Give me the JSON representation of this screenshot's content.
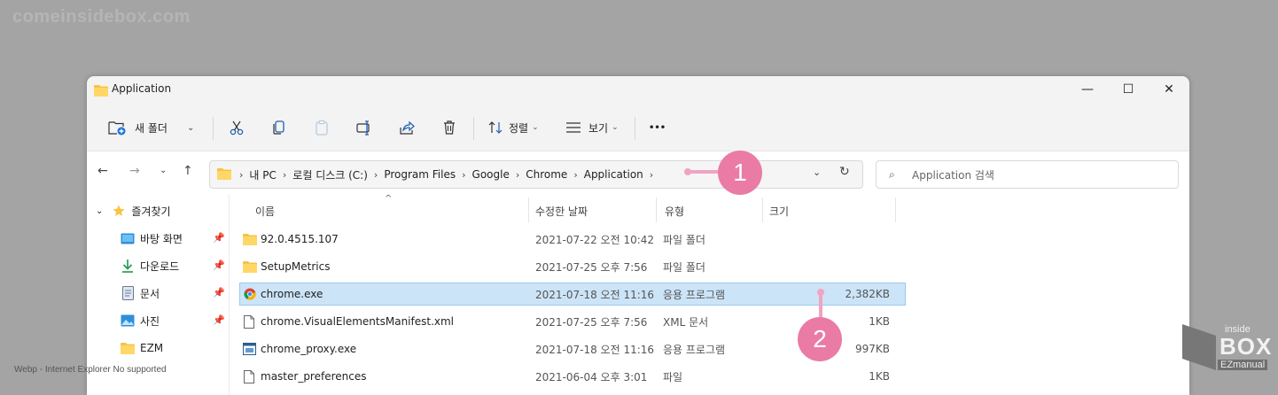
{
  "watermark": "comeinsidebox.com",
  "footer_note": "Webp - Internet Explorer No supported",
  "logo": {
    "line1": "inside",
    "line2": "BOX",
    "line3": "EZmanual"
  },
  "window": {
    "title": "Application",
    "controls": {
      "minimize": "—",
      "maximize": "☐",
      "close": "✕"
    }
  },
  "toolbar": {
    "new_folder": "새 폴더",
    "sort": "정렬",
    "view": "보기",
    "more": "•••"
  },
  "nav": {
    "breadcrumbs": [
      "내 PC",
      "로컬 디스크 (C:)",
      "Program Files",
      "Google",
      "Chrome",
      "Application"
    ],
    "search_placeholder": "Application 검색"
  },
  "sidebar": {
    "favorites_label": "즐겨찾기",
    "items": [
      {
        "label": "바탕 화면",
        "icon": "desktop-icon"
      },
      {
        "label": "다운로드",
        "icon": "download-icon"
      },
      {
        "label": "문서",
        "icon": "document-icon"
      },
      {
        "label": "사진",
        "icon": "picture-icon"
      },
      {
        "label": "EZM",
        "icon": "folder-icon"
      }
    ]
  },
  "columns": {
    "name": "이름",
    "date": "수정한 날짜",
    "type": "유형",
    "size": "크기"
  },
  "files": [
    {
      "name": "92.0.4515.107",
      "date": "2021-07-22 오전 10:42",
      "type": "파일 폴더",
      "size": "",
      "icon": "folder-icon"
    },
    {
      "name": "SetupMetrics",
      "date": "2021-07-25 오후 7:56",
      "type": "파일 폴더",
      "size": "",
      "icon": "folder-icon"
    },
    {
      "name": "chrome.exe",
      "date": "2021-07-18 오전 11:16",
      "type": "응용 프로그램",
      "size": "2,382KB",
      "icon": "chrome-icon",
      "selected": true
    },
    {
      "name": "chrome.VisualElementsManifest.xml",
      "date": "2021-07-25 오후 7:56",
      "type": "XML 문서",
      "size": "1KB",
      "icon": "file-icon"
    },
    {
      "name": "chrome_proxy.exe",
      "date": "2021-07-18 오전 11:16",
      "type": "응용 프로그램",
      "size": "997KB",
      "icon": "app-icon"
    },
    {
      "name": "master_preferences",
      "date": "2021-06-04 오후 3:01",
      "type": "파일",
      "size": "1KB",
      "icon": "file-icon"
    }
  ],
  "annotations": {
    "one": "1",
    "two": "2"
  },
  "colors": {
    "accent": "#ea7ba5",
    "selection": "#cce4f7",
    "folder": "#f6c443"
  }
}
